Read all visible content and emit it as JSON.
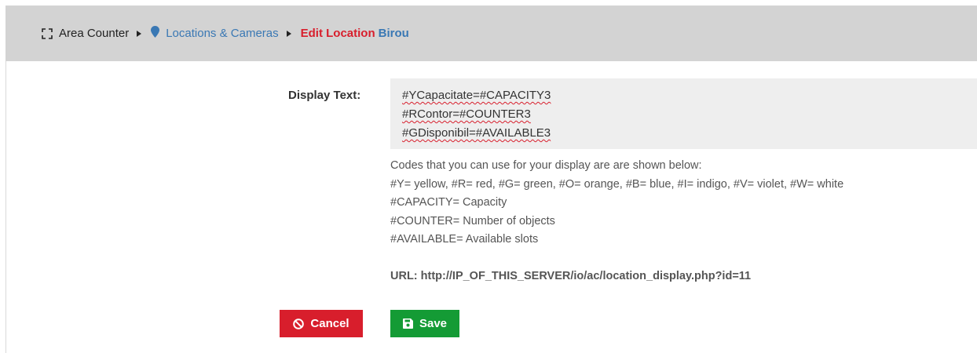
{
  "breadcrumb": {
    "area_counter": "Area Counter",
    "locations_cameras": "Locations & Cameras",
    "edit_location": "Edit Location",
    "location_name": "Birou"
  },
  "form": {
    "display_text_label": "Display Text:",
    "display_lines": [
      "#YCapacitate=#CAPACITY3",
      "#RContor=#COUNTER3",
      "#GDisponibil=#AVAILABLE3"
    ],
    "help_lines": [
      "Codes that you can use for your display are are shown below:",
      "#Y= yellow, #R= red, #G= green, #O= orange, #B= blue, #I= indigo, #V= violet, #W= white",
      "#CAPACITY= Capacity",
      "#COUNTER= Number of objects",
      "#AVAILABLE= Available slots"
    ],
    "url_text": "URL: http://IP_OF_THIS_SERVER/io/ac/location_display.php?id=11"
  },
  "buttons": {
    "cancel_label": "Cancel",
    "save_label": "Save"
  },
  "colors": {
    "cancel": "#d81e2c",
    "save": "#149b35",
    "link": "#3a78b4",
    "header_bg": "#d3d3d3"
  },
  "icons": {
    "area": "expand-corners-icon",
    "location": "map-pin-icon",
    "cancel": "ban-icon",
    "save": "floppy-disk-icon"
  }
}
